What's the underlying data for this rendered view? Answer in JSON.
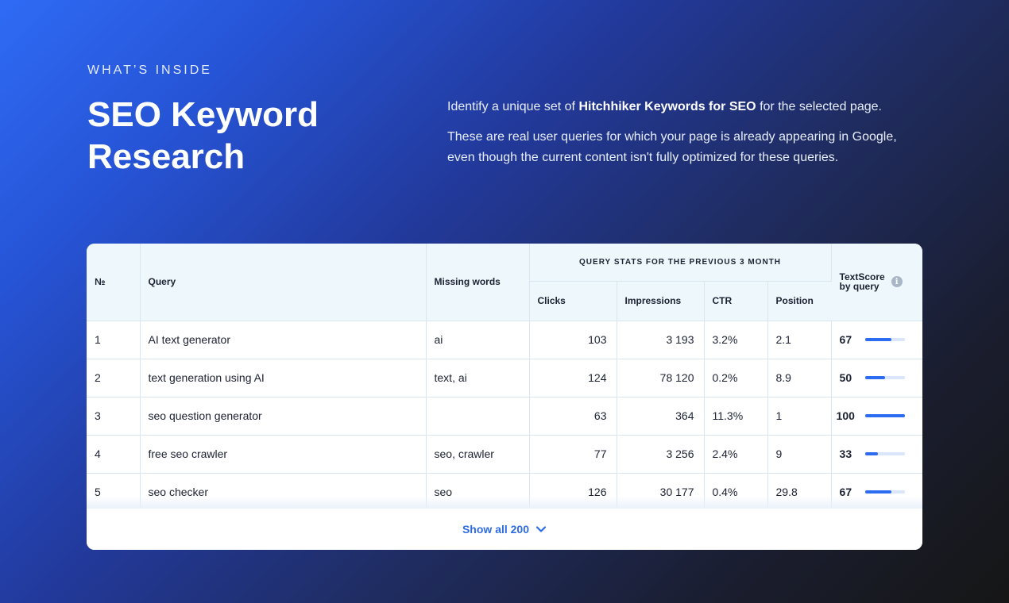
{
  "header": {
    "eyebrow": "WHAT’S INSIDE",
    "title": "SEO Keyword Research",
    "desc1_pre": "Identify a unique set of ",
    "desc1_bold": "Hitchhiker Keywords for SEO",
    "desc1_post": " for the selected page.",
    "desc2": "These are real user queries for which your page is already appearing in Google, even though the current content isn't fully optimized for these queries."
  },
  "table": {
    "columns": {
      "no": "№",
      "query": "Query",
      "missing": "Missing words",
      "group": "QUERY STATS FOR THE PREVIOUS 3 MONTH",
      "clicks": "Clicks",
      "impressions": "Impressions",
      "ctr": "CTR",
      "position": "Position",
      "textscore_line1": "TextScore",
      "textscore_line2": "by query"
    },
    "rows": [
      {
        "no": "1",
        "query": "AI text generator",
        "missing": "ai",
        "clicks": "103",
        "impressions": "3 193",
        "ctr": "3.2%",
        "position": "2.1",
        "score": "67",
        "score_pct": 67
      },
      {
        "no": "2",
        "query": "text generation using AI",
        "missing": "text, ai",
        "clicks": "124",
        "impressions": "78 120",
        "ctr": "0.2%",
        "position": "8.9",
        "score": "50",
        "score_pct": 50
      },
      {
        "no": "3",
        "query": "seo question generator",
        "missing": "",
        "clicks": "63",
        "impressions": "364",
        "ctr": "11.3%",
        "position": "1",
        "score": "100",
        "score_pct": 100
      },
      {
        "no": "4",
        "query": "free seo crawler",
        "missing": "seo, crawler",
        "clicks": "77",
        "impressions": "3 256",
        "ctr": "2.4%",
        "position": "9",
        "score": "33",
        "score_pct": 33
      },
      {
        "no": "5",
        "query": "seo checker",
        "missing": "seo",
        "clicks": "126",
        "impressions": "30 177",
        "ctr": "0.4%",
        "position": "29.8",
        "score": "67",
        "score_pct": 67
      }
    ],
    "show_all_label": "Show all 200"
  },
  "icons": {
    "info": "info-icon",
    "chevron": "chevron-down-icon"
  },
  "colors": {
    "accent": "#2c6cf0",
    "bar_track": "#dbe6fb",
    "header_bg": "#eef7fc"
  }
}
